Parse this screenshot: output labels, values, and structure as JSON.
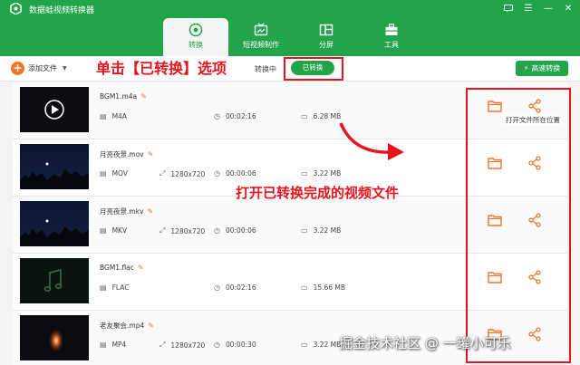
{
  "app": {
    "title": "数据蛙视频转换器"
  },
  "nav": [
    {
      "label": "转换",
      "icon": "convert-icon",
      "active": true
    },
    {
      "label": "短视频制作",
      "icon": "tv-icon",
      "active": false
    },
    {
      "label": "分屏",
      "icon": "split-screen-icon",
      "active": false
    },
    {
      "label": "工具",
      "icon": "toolbox-icon",
      "active": false
    }
  ],
  "toolbar": {
    "add_label": "添加文件",
    "converting_label": "转换中",
    "converted_label": "已转换",
    "fast_label": "高速转换"
  },
  "files": [
    {
      "name": "BGM1.m4a",
      "format": "M4A",
      "resolution": "",
      "duration": "00:02:16",
      "size": "6.28 MB",
      "thumb": "audio-play"
    },
    {
      "name": "月亮夜景.mov",
      "format": "MOV",
      "resolution": "1280x720",
      "duration": "00:00:06",
      "size": "3.22 MB",
      "thumb": "night-moon"
    },
    {
      "name": "月亮夜景.mkv",
      "format": "MKV",
      "resolution": "1280x720",
      "duration": "00:00:06",
      "size": "3.22 MB",
      "thumb": "night-moon"
    },
    {
      "name": "BGM1.flac",
      "format": "FLAC",
      "resolution": "",
      "duration": "00:02:16",
      "size": "15.66 MB",
      "thumb": "audio-note"
    },
    {
      "name": "老友聚会.mp4",
      "format": "MP4",
      "resolution": "1280x720",
      "duration": "00:00:30",
      "size": "3.22 MB",
      "thumb": "sparkle"
    }
  ],
  "annotations": {
    "top_instruction": "单击【已转换】选项",
    "middle_instruction": "打开已转换完成的视频文件",
    "tooltip": "打开文件所在位置"
  },
  "watermark": "掘金技术社区 @ 一罐小可乐",
  "colors": {
    "brand_green": "#22a44a",
    "accent_orange": "#f0772b",
    "annotation_red": "#e8131d"
  }
}
